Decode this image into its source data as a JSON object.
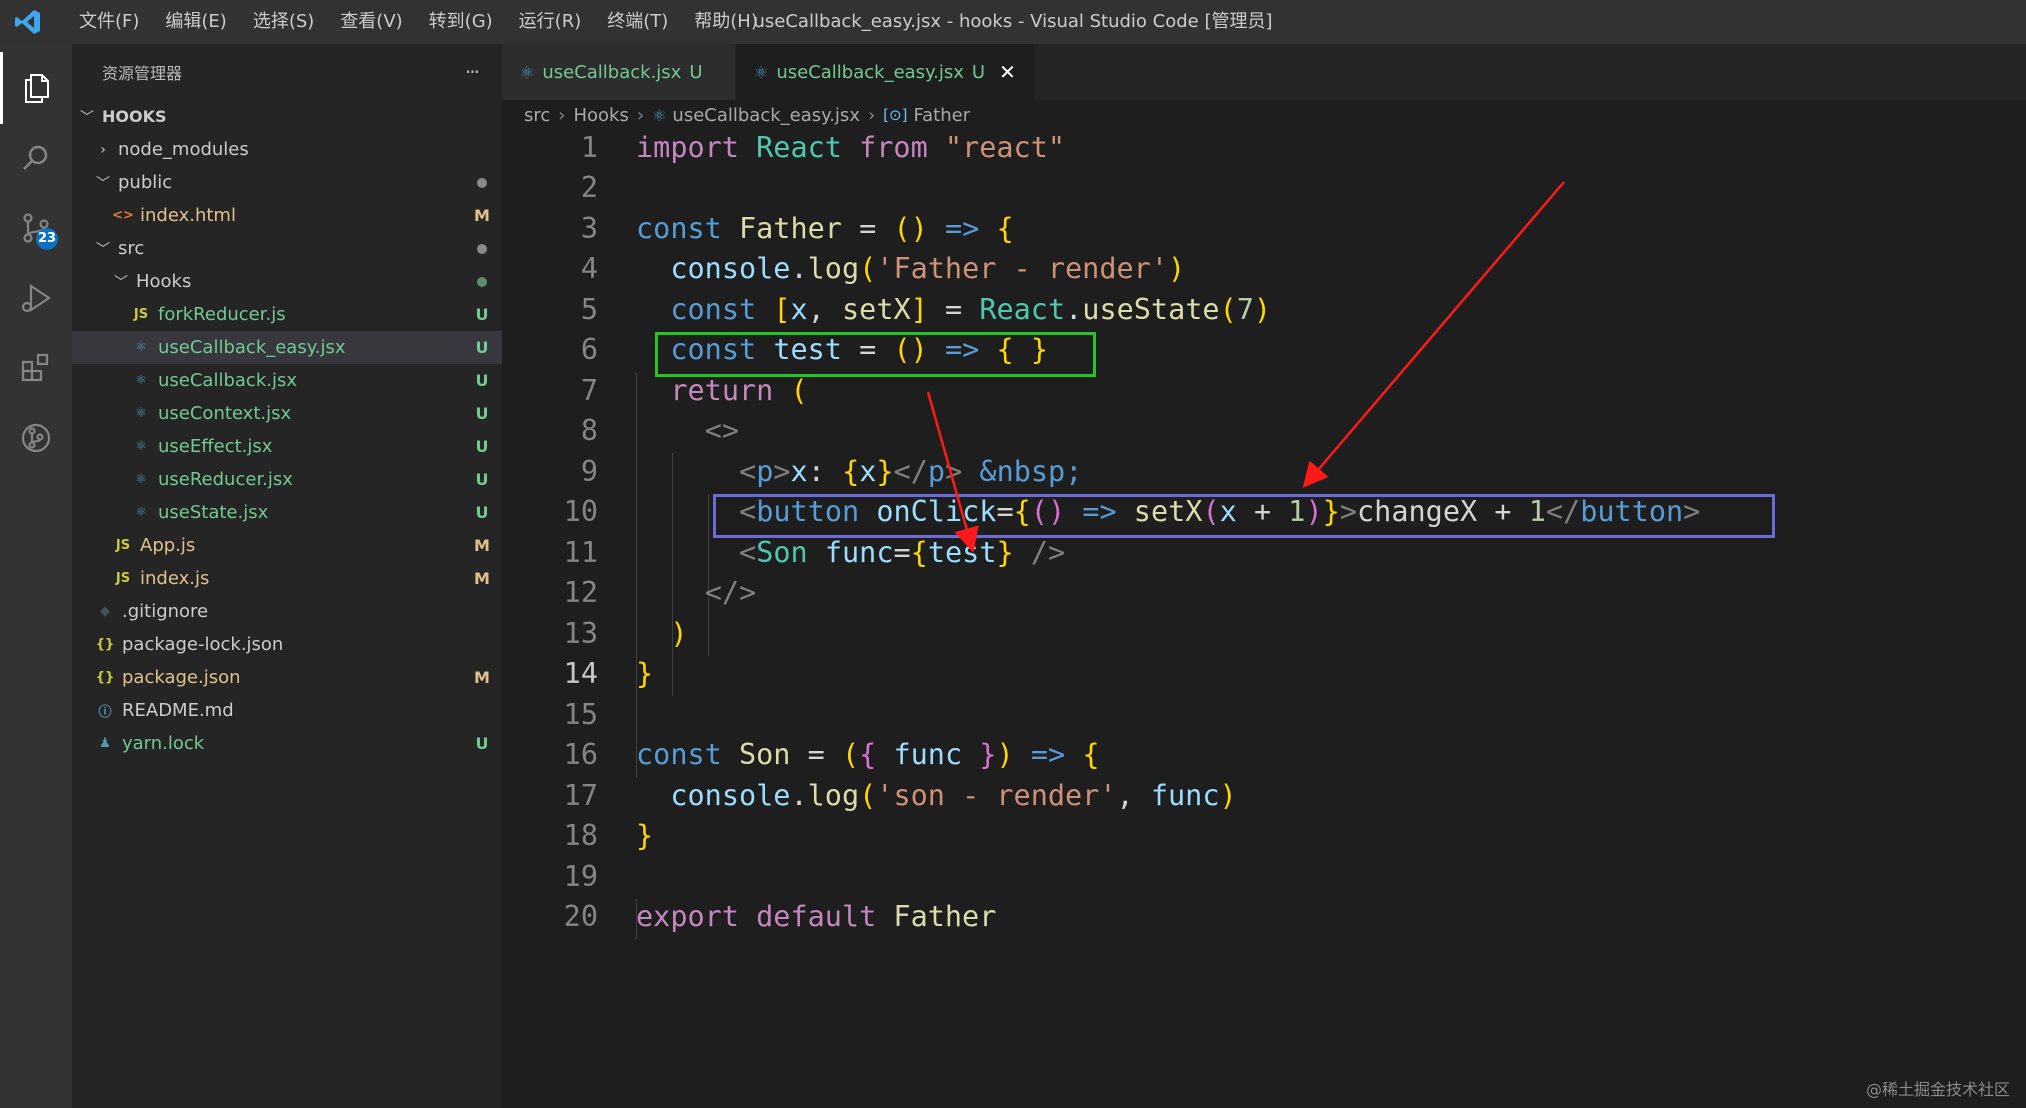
{
  "titlebar": {
    "menu": [
      "文件(F)",
      "编辑(E)",
      "选择(S)",
      "查看(V)",
      "转到(G)",
      "运行(R)",
      "终端(T)",
      "帮助(H)"
    ],
    "window_title": "useCallback_easy.jsx - hooks - Visual Studio Code [管理员]"
  },
  "activitybar": {
    "icons": [
      "explorer-icon",
      "search-icon",
      "source-control-icon",
      "run-debug-icon",
      "extensions-icon",
      "git-graph-icon"
    ],
    "scm_badge": "23"
  },
  "sidebar": {
    "title": "资源管理器",
    "more": "···",
    "root": "HOOKS",
    "items": [
      {
        "label": "node_modules",
        "kind": "folder-closed",
        "status": ""
      },
      {
        "label": "public",
        "kind": "folder-open",
        "status": "dot"
      },
      {
        "label": "index.html",
        "kind": "html",
        "status": "M"
      },
      {
        "label": "src",
        "kind": "folder-open",
        "status": "dot"
      },
      {
        "label": "Hooks",
        "kind": "folder-open",
        "status": "dot-green"
      },
      {
        "label": "forkReducer.js",
        "kind": "js",
        "status": "U"
      },
      {
        "label": "useCallback_easy.jsx",
        "kind": "jsx",
        "status": "U"
      },
      {
        "label": "useCallback.jsx",
        "kind": "jsx",
        "status": "U"
      },
      {
        "label": "useContext.jsx",
        "kind": "jsx",
        "status": "U"
      },
      {
        "label": "useEffect.jsx",
        "kind": "jsx",
        "status": "U"
      },
      {
        "label": "useReducer.jsx",
        "kind": "jsx",
        "status": "U"
      },
      {
        "label": "useState.jsx",
        "kind": "jsx",
        "status": "U"
      },
      {
        "label": "App.js",
        "kind": "js",
        "status": "M"
      },
      {
        "label": "index.js",
        "kind": "js",
        "status": "M"
      },
      {
        "label": ".gitignore",
        "kind": "git",
        "status": ""
      },
      {
        "label": "package-lock.json",
        "kind": "json",
        "status": ""
      },
      {
        "label": "package.json",
        "kind": "json",
        "status": "M"
      },
      {
        "label": "README.md",
        "kind": "info",
        "status": ""
      },
      {
        "label": "yarn.lock",
        "kind": "yarn",
        "status": "U"
      }
    ]
  },
  "tabs": [
    {
      "label": "useCallback.jsx",
      "status": "U",
      "active": false
    },
    {
      "label": "useCallback_easy.jsx",
      "status": "U",
      "active": true,
      "close": "✕"
    }
  ],
  "breadcrumb": [
    "src",
    "Hooks",
    "useCallback_easy.jsx",
    "Father"
  ],
  "editor": {
    "current_line": 14,
    "lines": [
      "import React from \"react\"",
      "",
      "const Father = () => {",
      "  console.log('Father - render')",
      "  const [x, setX] = React.useState(7)",
      "  const test = () => { }",
      "  return (",
      "    <>",
      "      <p>x: {x}</p> &nbsp;",
      "      <button onClick={() => setX(x + 1)}>changeX + 1</button>",
      "      <Son func={test} />",
      "    </>",
      "  )",
      "}",
      "",
      "const Son = ({ func }) => {",
      "  console.log('son - render', func)",
      "}",
      "",
      "export default Father"
    ]
  },
  "watermark": "@稀土掘金技术社区"
}
